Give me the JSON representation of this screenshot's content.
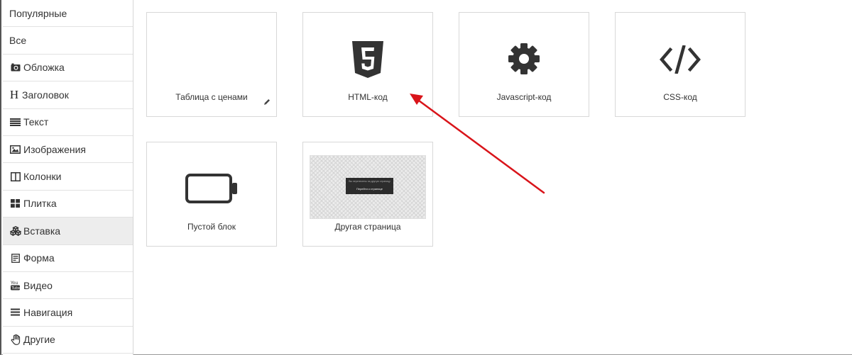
{
  "sidebar": {
    "items": [
      {
        "label": "Популярные",
        "icon": ""
      },
      {
        "label": "Все",
        "icon": ""
      },
      {
        "label": "Обложка",
        "icon": "camera-icon"
      },
      {
        "label": "Заголовок",
        "icon": "heading-icon",
        "glyph": "H"
      },
      {
        "label": "Текст",
        "icon": "text-lines-icon"
      },
      {
        "label": "Изображения",
        "icon": "picture-icon"
      },
      {
        "label": "Колонки",
        "icon": "columns-icon"
      },
      {
        "label": "Плитка",
        "icon": "grid-icon"
      },
      {
        "label": "Вставка",
        "icon": "cubes-icon",
        "active": true
      },
      {
        "label": "Форма",
        "icon": "form-icon"
      },
      {
        "label": "Видео",
        "icon": "youtube-icon"
      },
      {
        "label": "Навигация",
        "icon": "menu-icon"
      },
      {
        "label": "Другие",
        "icon": "hand-icon"
      }
    ]
  },
  "cards": [
    {
      "label": "Таблица с ценами",
      "icon": "pencil-icon"
    },
    {
      "label": "HTML-код",
      "icon": "html5-icon"
    },
    {
      "label": "Javascript-код",
      "icon": "gear-icon"
    },
    {
      "label": "CSS-код",
      "icon": "code-icon"
    },
    {
      "label": "Пустой блок",
      "icon": "battery-empty-icon"
    },
    {
      "label": "Другая страница",
      "icon": "page-thumbnail",
      "thumb_text_1": "Вы перенесены на другую страницу",
      "thumb_text_2": "Перейти к странице"
    }
  ],
  "colors": {
    "arrow": "#d9141a",
    "icon": "#333333",
    "active_bg": "#ededed"
  }
}
